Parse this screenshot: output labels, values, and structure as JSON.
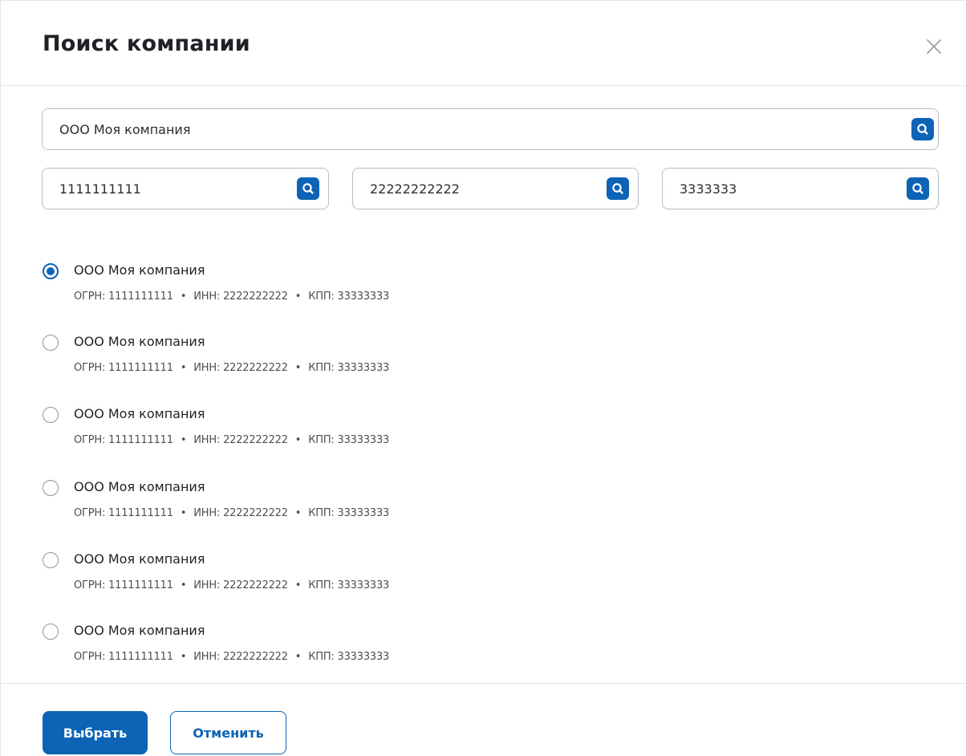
{
  "dialog": {
    "title": "Поиск компании"
  },
  "search": {
    "company_name": "ООО Моя компания",
    "ogrn": "1111111111",
    "inn": "22222222222",
    "kpp": "3333333"
  },
  "results": [
    {
      "name": "ООО Моя компания",
      "ogrn": "ОГРН: 1111111111",
      "inn": "ИНН: 2222222222",
      "kpp": "КПП: 33333333",
      "selected": true
    },
    {
      "name": "ООО Моя компания",
      "ogrn": "ОГРН: 1111111111",
      "inn": "ИНН: 2222222222",
      "kpp": "КПП: 33333333",
      "selected": false
    },
    {
      "name": "ООО Моя компания",
      "ogrn": "ОГРН: 1111111111",
      "inn": "ИНН: 2222222222",
      "kpp": "КПП: 33333333",
      "selected": false
    },
    {
      "name": "ООО Моя компания",
      "ogrn": "ОГРН: 1111111111",
      "inn": "ИНН: 2222222222",
      "kpp": "КПП: 33333333",
      "selected": false
    },
    {
      "name": "ООО Моя компания",
      "ogrn": "ОГРН: 1111111111",
      "inn": "ИНН: 2222222222",
      "kpp": "КПП: 33333333",
      "selected": false
    },
    {
      "name": "ООО Моя компания",
      "ogrn": "ОГРН: 1111111111",
      "inn": "ИНН: 2222222222",
      "kpp": "КПП: 33333333",
      "selected": false
    }
  ],
  "separator": "•",
  "footer": {
    "select_label": "Выбрать",
    "cancel_label": "Отменить"
  },
  "icons": {
    "close": "close-icon",
    "search": "search-icon"
  },
  "colors": {
    "accent": "#0d64b6",
    "border": "#b9bec6",
    "divider": "#e3e6ea"
  }
}
